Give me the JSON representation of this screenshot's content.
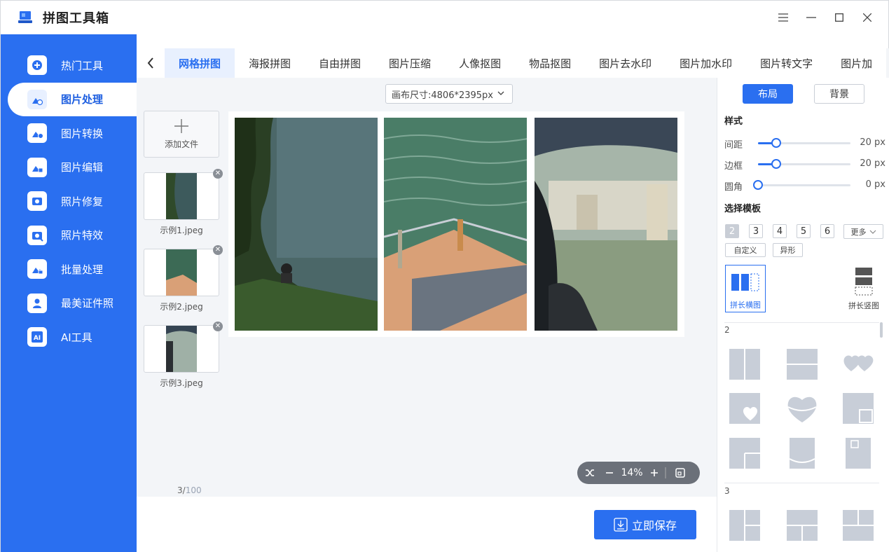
{
  "app": {
    "title": "拼图工具箱"
  },
  "window_controls": {
    "menu": "☰",
    "minimize": "—",
    "maximize": "☐",
    "close": "✕"
  },
  "sidebar": {
    "items": [
      {
        "label": "热门工具",
        "icon": "hot-tools-icon"
      },
      {
        "label": "图片处理",
        "icon": "image-process-icon",
        "active": true
      },
      {
        "label": "图片转换",
        "icon": "image-convert-icon"
      },
      {
        "label": "图片编辑",
        "icon": "image-edit-icon"
      },
      {
        "label": "照片修复",
        "icon": "photo-repair-icon"
      },
      {
        "label": "照片特效",
        "icon": "photo-effects-icon"
      },
      {
        "label": "批量处理",
        "icon": "batch-process-icon"
      },
      {
        "label": "最美证件照",
        "icon": "id-photo-icon"
      },
      {
        "label": "AI工具",
        "icon": "ai-tools-icon"
      }
    ]
  },
  "tabs": [
    {
      "label": "网格拼图",
      "active": true
    },
    {
      "label": "海报拼图"
    },
    {
      "label": "自由拼图"
    },
    {
      "label": "图片压缩"
    },
    {
      "label": "人像抠图"
    },
    {
      "label": "物品抠图"
    },
    {
      "label": "图片去水印"
    },
    {
      "label": "图片加水印"
    },
    {
      "label": "图片转文字"
    },
    {
      "label": "图片加"
    }
  ],
  "canvas": {
    "size_label": "画布尺寸:4806*2395px"
  },
  "files": {
    "add_label": "添加文件",
    "items": [
      {
        "name": "示例1.jpeg"
      },
      {
        "name": "示例2.jpeg"
      },
      {
        "name": "示例3.jpeg"
      }
    ],
    "count": "3/",
    "max": "100"
  },
  "zoom": {
    "level": "14%"
  },
  "save": {
    "label": "立即保存"
  },
  "panel": {
    "tab_layout": "布局",
    "tab_background": "背景",
    "style_title": "样式",
    "sliders": [
      {
        "label": "间距",
        "value": "20 px",
        "fraction": 0.2
      },
      {
        "label": "边框",
        "value": "20 px",
        "fraction": 0.2
      },
      {
        "label": "圆角",
        "value": "0 px",
        "fraction": 0
      }
    ],
    "template_title": "选择模板",
    "counts": [
      "2",
      "3",
      "4",
      "5",
      "6"
    ],
    "more": "更多",
    "custom": "自定义",
    "special": "异形",
    "type_horizontal": "拼长横图",
    "type_vertical": "拼长竖图",
    "group2": "2",
    "group3": "3"
  },
  "colors": {
    "accent": "#2a6ff0",
    "sidebar": "#2a6ff0",
    "template_gray": "#c8ced8"
  }
}
